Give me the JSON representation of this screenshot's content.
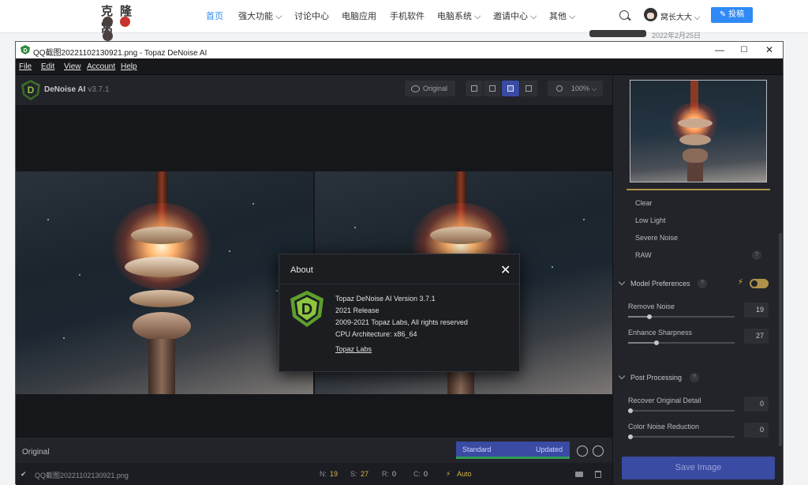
{
  "site": {
    "logo_text": "克隆窝",
    "nav": [
      "首页",
      "强大功能 ⌵",
      "讨论中心",
      "电脑应用",
      "手机软件",
      "电脑系统 ⌵",
      "邀请中心 ⌵",
      "其他 ⌵"
    ],
    "user_name": "窝长大大 ⌵",
    "post_button": "✎ 投稿",
    "date_text": "2022年2月25日"
  },
  "window": {
    "title": "QQ截图20221102130921.png - Topaz DeNoise AI",
    "controls": [
      "—",
      "☐",
      "✕"
    ]
  },
  "menu": [
    "File",
    "Edit",
    "View",
    "Account",
    "Help"
  ],
  "app": {
    "brand": "DeNoise AI",
    "version": "v3.7.1",
    "original_button": "Original",
    "zoom": "100%",
    "zoom_caret": "⌵"
  },
  "bottom": {
    "original_label": "Original",
    "mode_standard": "Standard",
    "mode_updated": "Updated"
  },
  "status": {
    "check": "✔",
    "filename": "QQ截图20221102130921.png",
    "n_label": "N:",
    "n_value": "19",
    "s_label": "S:",
    "s_value": "27",
    "r_label": "R:",
    "r_value": "0",
    "c_label": "C:",
    "c_value": "0",
    "auto": "Auto",
    "bolt": "⚡"
  },
  "sidebar": {
    "models": [
      "Clear",
      "Low Light",
      "Severe Noise",
      "RAW"
    ],
    "help_glyph": "?",
    "model_prefs": "Model Preferences",
    "remove_noise_label": "Remove Noise",
    "remove_noise_value": "19",
    "remove_noise_level": 0.2,
    "enhance_sharpness_label": "Enhance Sharpness",
    "enhance_sharpness_value": "27",
    "enhance_sharpness_level": 0.27,
    "post_processing": "Post Processing",
    "recover_label": "Recover Original Detail",
    "recover_value": "0",
    "color_noise_label": "Color Noise Reduction",
    "color_noise_value": "0",
    "save_button": "Save Image"
  },
  "about": {
    "title": "About",
    "close": "✕",
    "lines": [
      "Topaz DeNoise AI Version 3.7.1",
      "2021 Release",
      "2009-2021 Topaz Labs, All rights reserved",
      "CPU Architecture: x86_64"
    ],
    "link": "Topaz Labs"
  },
  "colors": {
    "accent": "#3a4ba3",
    "gold": "#b0914a",
    "brand_green": "#8cc63f"
  }
}
